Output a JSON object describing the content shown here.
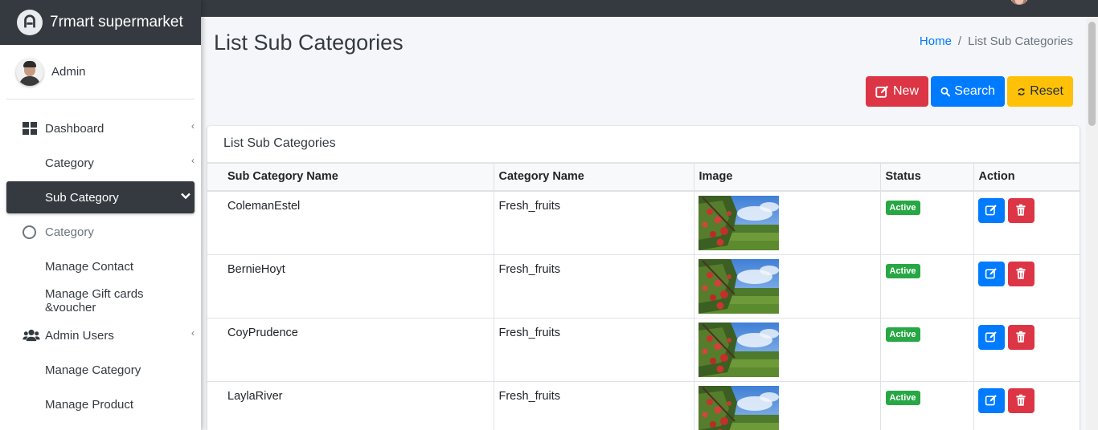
{
  "brand": {
    "name": "7rmart supermarket"
  },
  "user": {
    "name": "Admin"
  },
  "sidebar": {
    "items": [
      {
        "label": "Dashboard",
        "icon": "dashboard-icon",
        "caret": "‹"
      },
      {
        "label": "Category",
        "icon": "",
        "caret": "‹"
      },
      {
        "label": "Sub Category",
        "icon": "",
        "caret": "chevron-down"
      },
      {
        "label": "Category",
        "icon": "circle-icon"
      },
      {
        "label": "Manage Contact",
        "icon": ""
      },
      {
        "label": "Manage Gift cards &voucher",
        "icon": ""
      },
      {
        "label": "Admin Users",
        "icon": "users-icon",
        "caret": "‹"
      },
      {
        "label": "Manage Category",
        "icon": ""
      },
      {
        "label": "Manage Product",
        "icon": ""
      }
    ]
  },
  "page": {
    "title": "List Sub Categories"
  },
  "breadcrumb": {
    "home": "Home",
    "separator": "/",
    "current": "List Sub Categories"
  },
  "toolbar": {
    "new_label": "New",
    "search_label": "Search",
    "reset_label": "Reset"
  },
  "card": {
    "title": "List Sub Categories"
  },
  "table": {
    "headers": [
      "Sub Category Name",
      "Category Name",
      "Image",
      "Status",
      "Action"
    ],
    "rows": [
      {
        "name": "ColemanEstel",
        "category": "Fresh_fruits",
        "status": "Active"
      },
      {
        "name": "BernieHoyt",
        "category": "Fresh_fruits",
        "status": "Active"
      },
      {
        "name": "CoyPrudence",
        "category": "Fresh_fruits",
        "status": "Active"
      },
      {
        "name": "LaylaRiver",
        "category": "Fresh_fruits",
        "status": "Active"
      }
    ]
  },
  "colors": {
    "sidebar_dark": "#343a40",
    "primary": "#007bff",
    "danger": "#dc3545",
    "warning": "#ffc107",
    "success": "#28a745"
  }
}
